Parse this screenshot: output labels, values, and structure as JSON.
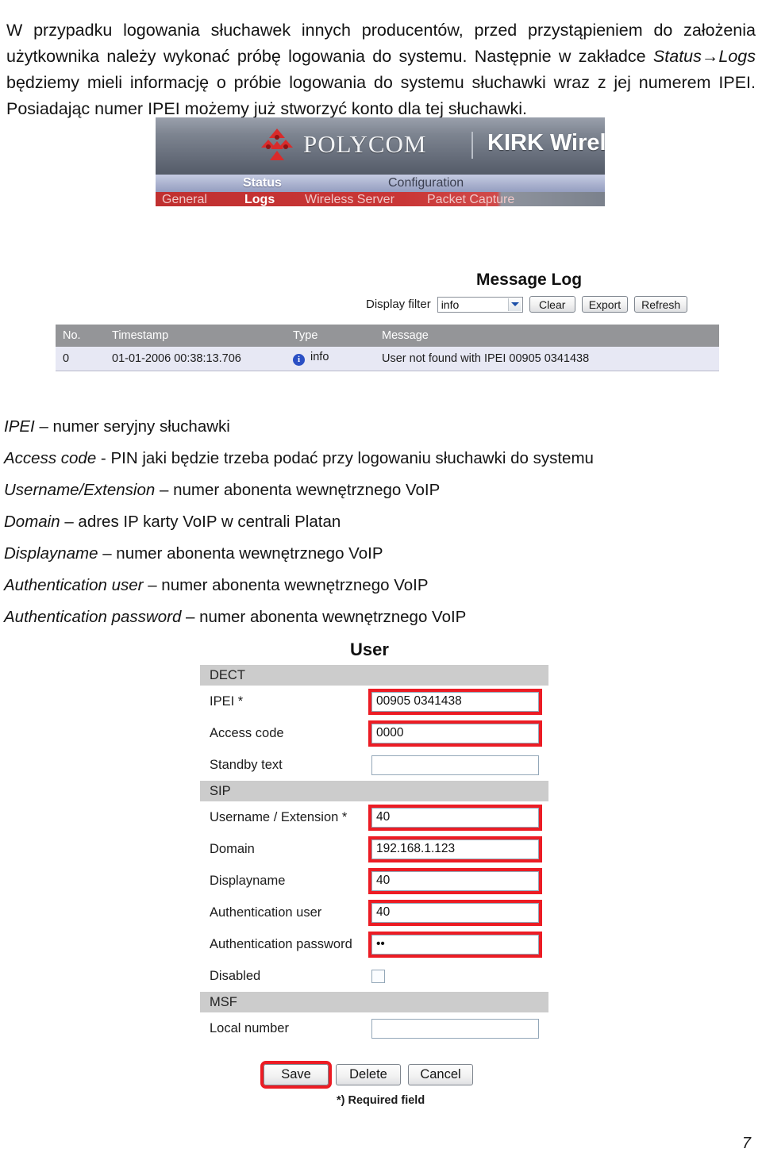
{
  "document": {
    "page_number": "7",
    "intro_paragraph": {
      "part1": "W przypadku logowania słuchawek innych producentów, przed przystąpieniem do założenia użytkownika należy wykonać próbę logowania do systemu. Następnie w zakładce ",
      "emphasis": "Status→Logs",
      "part2": " będziemy mieli informację o próbie logowania do systemu słuchawki wraz z jej numerem IPEI. Posiadając numer IPEI możemy już stworzyć konto dla tej słuchawki."
    }
  },
  "polycom_screenshot": {
    "brand": "POLYCOM",
    "product": "KIRK Wireless Se",
    "logo_icon": "polycom-logo-icon",
    "primary_nav": [
      {
        "label": "Status",
        "selected": true
      },
      {
        "label": "Configuration",
        "selected": false
      }
    ],
    "secondary_nav": [
      {
        "label": "General",
        "selected": false
      },
      {
        "label": "Logs",
        "selected": true
      },
      {
        "label": "Wireless Server",
        "selected": false
      },
      {
        "label": "Packet Capture",
        "selected": false
      }
    ]
  },
  "message_log": {
    "title": "Message Log",
    "filter_label": "Display filter",
    "filter_value": "info",
    "filter_options": [
      "info"
    ],
    "buttons": [
      {
        "label": "Clear"
      },
      {
        "label": "Export"
      },
      {
        "label": "Refresh"
      }
    ],
    "columns": [
      "No.",
      "Timestamp",
      "Type",
      "Message"
    ],
    "rows": [
      {
        "no": "0",
        "timestamp": "01-01-2006 00:38:13.706",
        "type": "info",
        "type_icon": "info-circle-icon",
        "message": "User not found with IPEI 00905 0341438"
      }
    ]
  },
  "definitions": [
    {
      "term": "IPEI",
      "desc": " – numer seryjny słuchawki"
    },
    {
      "term": "Access code",
      "desc": "  - PIN jaki będzie trzeba podać przy logowaniu słuchawki do systemu"
    },
    {
      "term": "Username/Extension",
      "desc": " – numer abonenta wewnętrznego VoIP"
    },
    {
      "term": "Domain",
      "desc": " – adres IP karty VoIP w centrali Platan"
    },
    {
      "term": "Displayname",
      "desc": " – numer abonenta wewnętrznego VoIP"
    },
    {
      "term": "Authentication user",
      "desc": " – numer abonenta wewnętrznego VoIP"
    },
    {
      "term": "Authentication password",
      "desc": " – numer abonenta wewnętrznego VoIP"
    }
  ],
  "user_form": {
    "title": "User",
    "sections": [
      {
        "heading": "DECT",
        "fields": [
          {
            "label": "IPEI *",
            "value": "00905 0341438",
            "highlighted": true,
            "type": "text"
          },
          {
            "label": "Access code",
            "value": "0000",
            "highlighted": true,
            "type": "text"
          },
          {
            "label": "Standby text",
            "value": "",
            "highlighted": false,
            "type": "text"
          }
        ]
      },
      {
        "heading": "SIP",
        "fields": [
          {
            "label": "Username / Extension *",
            "value": "40",
            "highlighted": true,
            "type": "text"
          },
          {
            "label": "Domain",
            "value": "192.168.1.123",
            "highlighted": true,
            "type": "text"
          },
          {
            "label": "Displayname",
            "value": "40",
            "highlighted": true,
            "type": "text"
          },
          {
            "label": "Authentication user",
            "value": "40",
            "highlighted": true,
            "type": "text"
          },
          {
            "label": "Authentication password",
            "value": "••",
            "highlighted": true,
            "type": "password"
          },
          {
            "label": "Disabled",
            "value": "",
            "highlighted": false,
            "type": "checkbox"
          }
        ]
      },
      {
        "heading": "MSF",
        "fields": [
          {
            "label": "Local number",
            "value": "",
            "highlighted": false,
            "type": "text"
          }
        ]
      }
    ],
    "buttons": [
      {
        "label": "Save",
        "highlighted": true
      },
      {
        "label": "Delete",
        "highlighted": false
      },
      {
        "label": "Cancel",
        "highlighted": false
      }
    ],
    "required_note": "*) Required field"
  },
  "colors": {
    "highlight_red": "#ec1c24",
    "section_header_gray": "#cccccc",
    "table_header_gray": "#949598",
    "table_row_lavender": "#e7e8f4",
    "nav_red": "#c93636",
    "info_blue": "#2a4fc4"
  }
}
